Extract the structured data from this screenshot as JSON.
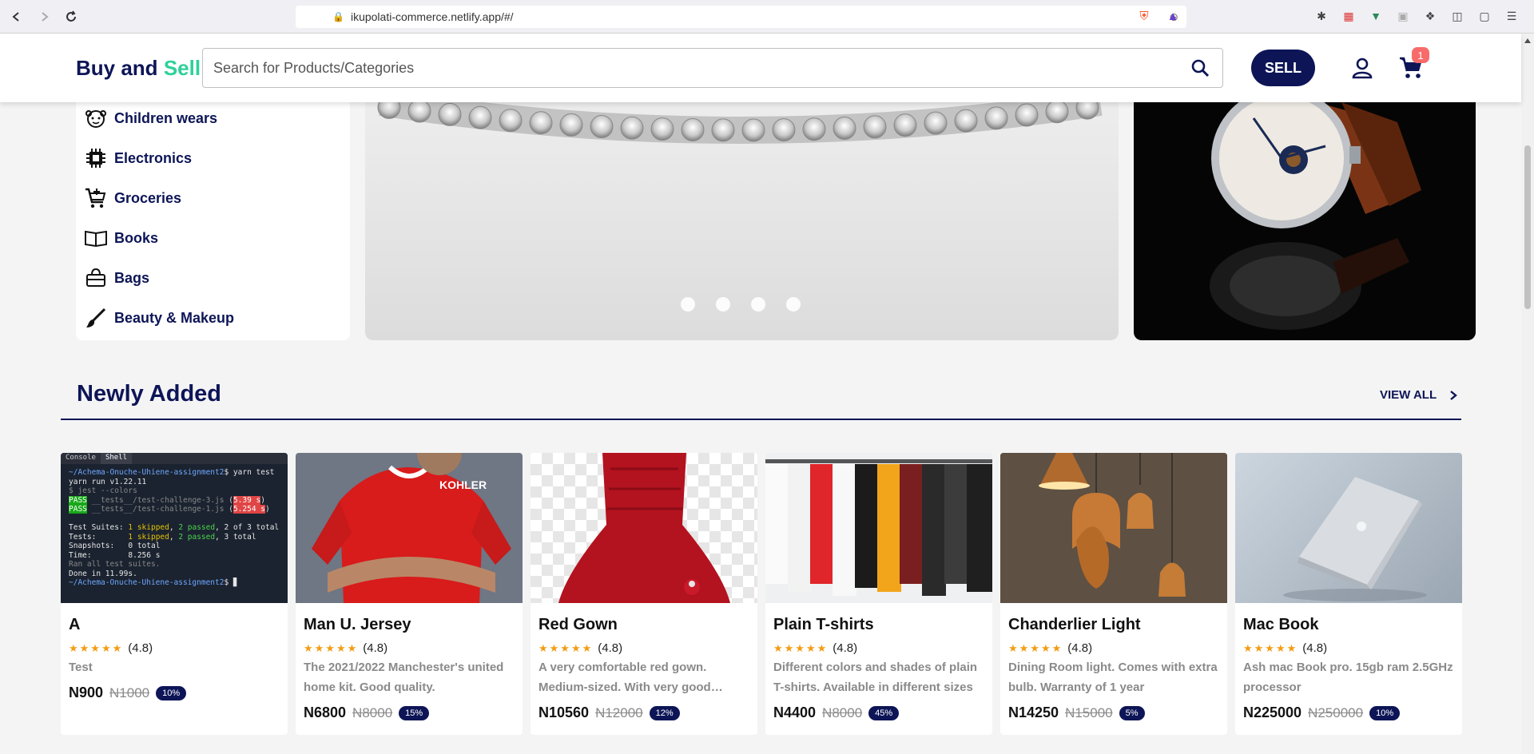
{
  "browser": {
    "url": "ikupolati-commerce.netlify.app/#/"
  },
  "header": {
    "logo_main": "Buy and",
    "logo_accent": "Sell",
    "search_placeholder": "Search for Products/Categories",
    "sell_label": "SELL",
    "cart_count": "1"
  },
  "categories": [
    {
      "label": "Children wears",
      "icon": "baby-icon"
    },
    {
      "label": "Electronics",
      "icon": "chip-icon"
    },
    {
      "label": "Groceries",
      "icon": "cart-icon"
    },
    {
      "label": "Books",
      "icon": "book-icon"
    },
    {
      "label": "Bags",
      "icon": "bag-icon"
    },
    {
      "label": "Beauty & Makeup",
      "icon": "brush-icon"
    }
  ],
  "section": {
    "title": "Newly Added",
    "view_all": "VIEW ALL"
  },
  "products": [
    {
      "name": "A",
      "rating": "(4.8)",
      "desc": "Test",
      "price": "N900",
      "old_price": "N1000",
      "discount": "10%",
      "image": "terminal-screenshot"
    },
    {
      "name": "Man U. Jersey",
      "rating": "(4.8)",
      "desc": "The 2021/2022 Manchester's united home kit. Good quality.",
      "price": "N6800",
      "old_price": "N8000",
      "discount": "15%",
      "image": "red-jersey"
    },
    {
      "name": "Red Gown",
      "rating": "(4.8)",
      "desc": "A very comfortable red gown. Medium-sized. With very good…",
      "price": "N10560",
      "old_price": "N12000",
      "discount": "12%",
      "image": "red-gown"
    },
    {
      "name": "Plain T-shirts",
      "rating": "(4.8)",
      "desc": "Different colors and shades of plain T-shirts. Available in different sizes",
      "price": "N4400",
      "old_price": "N8000",
      "discount": "45%",
      "image": "tshirt-rack"
    },
    {
      "name": "Chanderlier Light",
      "rating": "(4.8)",
      "desc": "Dining Room light. Comes with extra bulb. Warranty of 1 year",
      "price": "N14250",
      "old_price": "N15000",
      "discount": "5%",
      "image": "pendant-lights"
    },
    {
      "name": "Mac Book",
      "rating": "(4.8)",
      "desc": "Ash mac Book pro. 15gb ram 2.5GHz processor",
      "price": "N225000",
      "old_price": "N250000",
      "discount": "10%",
      "image": "macbook"
    }
  ],
  "terminal": {
    "tab_console": "Console",
    "tab_shell": "Shell",
    "prompt1": "~/Achema-Onuche-Uhiene-assignment2",
    "cmd1": "$ yarn test",
    "line2": "yarn run v1.22.11",
    "line3": "$ jest --colors",
    "pass": "PASS",
    "file1": "__tests__/test-challenge-3.js",
    "time1": "5.39 s",
    "file2": "__tests__/test-challenge-1.js",
    "time2": "5.254 s",
    "suites_label": "Test Suites:",
    "suites_skipped": "1 skipped",
    "suites_passed": "2 passed",
    "suites_total": ", 2 of 3 total",
    "tests_label": "Tests:",
    "tests_skipped": "1 skipped",
    "tests_passed": "2 passed",
    "tests_total": ", 3 total",
    "snap_label": "Snapshots:",
    "snap_val": "0 total",
    "time_label": "Time:",
    "time_val": "8.256 s",
    "ran": "Ran all test suites.",
    "done": "Done in 11.99s.",
    "prompt2": "~/Achema-Onuche-Uhiene-assignment2"
  },
  "colors": {
    "brand_navy": "#0d1557",
    "brand_green": "#2ed19a",
    "star": "#f39c12",
    "badge": "#f76b6b"
  }
}
